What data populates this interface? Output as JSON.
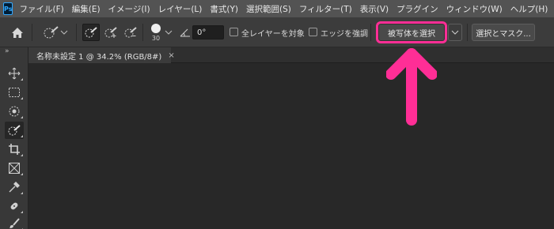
{
  "app": {
    "logo_text": "Ps"
  },
  "menu": [
    "ファイル(F)",
    "編集(E)",
    "イメージ(I)",
    "レイヤー(L)",
    "書式(Y)",
    "選択範囲(S)",
    "フィルター(T)",
    "表示(V)",
    "プラグイン",
    "ウィンドウ(W)",
    "ヘルプ(H)"
  ],
  "options": {
    "brush_size": "30",
    "angle_value": "0°",
    "sample_all_layers": "全レイヤーを対象",
    "enhance_edge": "エッジを強調",
    "select_subject": "被写体を選択",
    "select_and_mask": "選択とマスク..."
  },
  "document": {
    "tab_title": "名称未設定 1 @ 34.2% (RGB/8#)",
    "close_glyph": "×"
  },
  "toolbar": {
    "collapse_glyph": "»"
  },
  "annotation": {
    "arrow_color": "#ff2e96",
    "highlight_color": "#ff2e96"
  }
}
